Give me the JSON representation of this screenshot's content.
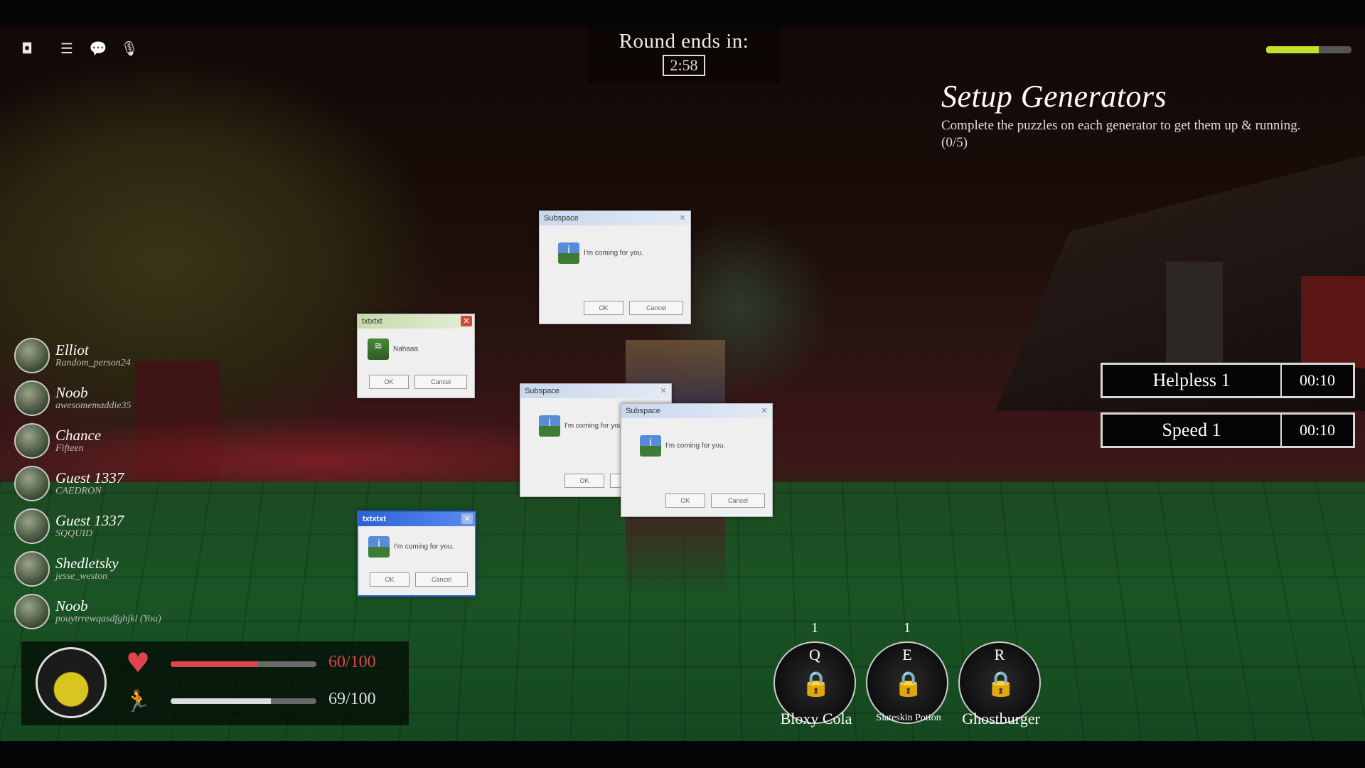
{
  "timer": {
    "label": "Round ends in:",
    "value": "2:58"
  },
  "topbar": {
    "roblox_icon": "roblox-logo-icon",
    "menu_icon": "menu-icon",
    "chat_icon": "chat-icon",
    "mic_icon": "mic-icon"
  },
  "stamina_top": {
    "level": 0.62,
    "color": "#c3e02a"
  },
  "objective": {
    "title": "Setup Generators",
    "description": "Complete the puzzles on each generator to get them up & running. (0/5)"
  },
  "effects": [
    {
      "name": "Helpless 1",
      "time": "00:10"
    },
    {
      "name": "Speed 1",
      "time": "00:10"
    }
  ],
  "players": [
    {
      "display": "Elliot",
      "user": "Random_person24"
    },
    {
      "display": "Noob",
      "user": "awesomemaddie35"
    },
    {
      "display": "Chance",
      "user": "Fifteen"
    },
    {
      "display": "Guest 1337",
      "user": "CAEDRON"
    },
    {
      "display": "Guest 1337",
      "user": "SQQUID"
    },
    {
      "display": "Shedletsky",
      "user": "jesse_weston"
    },
    {
      "display": "Noob",
      "user": "pouytrrewqasdfghjkl (You)"
    }
  ],
  "stats": {
    "health": {
      "value": "60/100",
      "level": 0.6,
      "color": "#e0454f"
    },
    "stamina": {
      "value": "69/100",
      "level": 0.69,
      "color": "#dcdcdc"
    }
  },
  "abilities": [
    {
      "key": "Q",
      "count": "1",
      "name": "Bloxy Cola"
    },
    {
      "key": "E",
      "count": "1",
      "name": "Slateskin Potion"
    },
    {
      "key": "R",
      "count": "",
      "name": "Ghostburger"
    }
  ],
  "popups": [
    {
      "title": "Subspace",
      "message": "I'm coming for you."
    },
    {
      "title": "txtxtxt",
      "message": "Nahaaa"
    },
    {
      "title": "Subspace",
      "message": "I'm coming for you."
    },
    {
      "title": "Subspace",
      "message": "I'm coming for you."
    },
    {
      "title": "txtxtxt",
      "message": "I'm coming for you."
    }
  ],
  "popup_buttons": {
    "ok": "OK",
    "cancel": "Cancel"
  }
}
